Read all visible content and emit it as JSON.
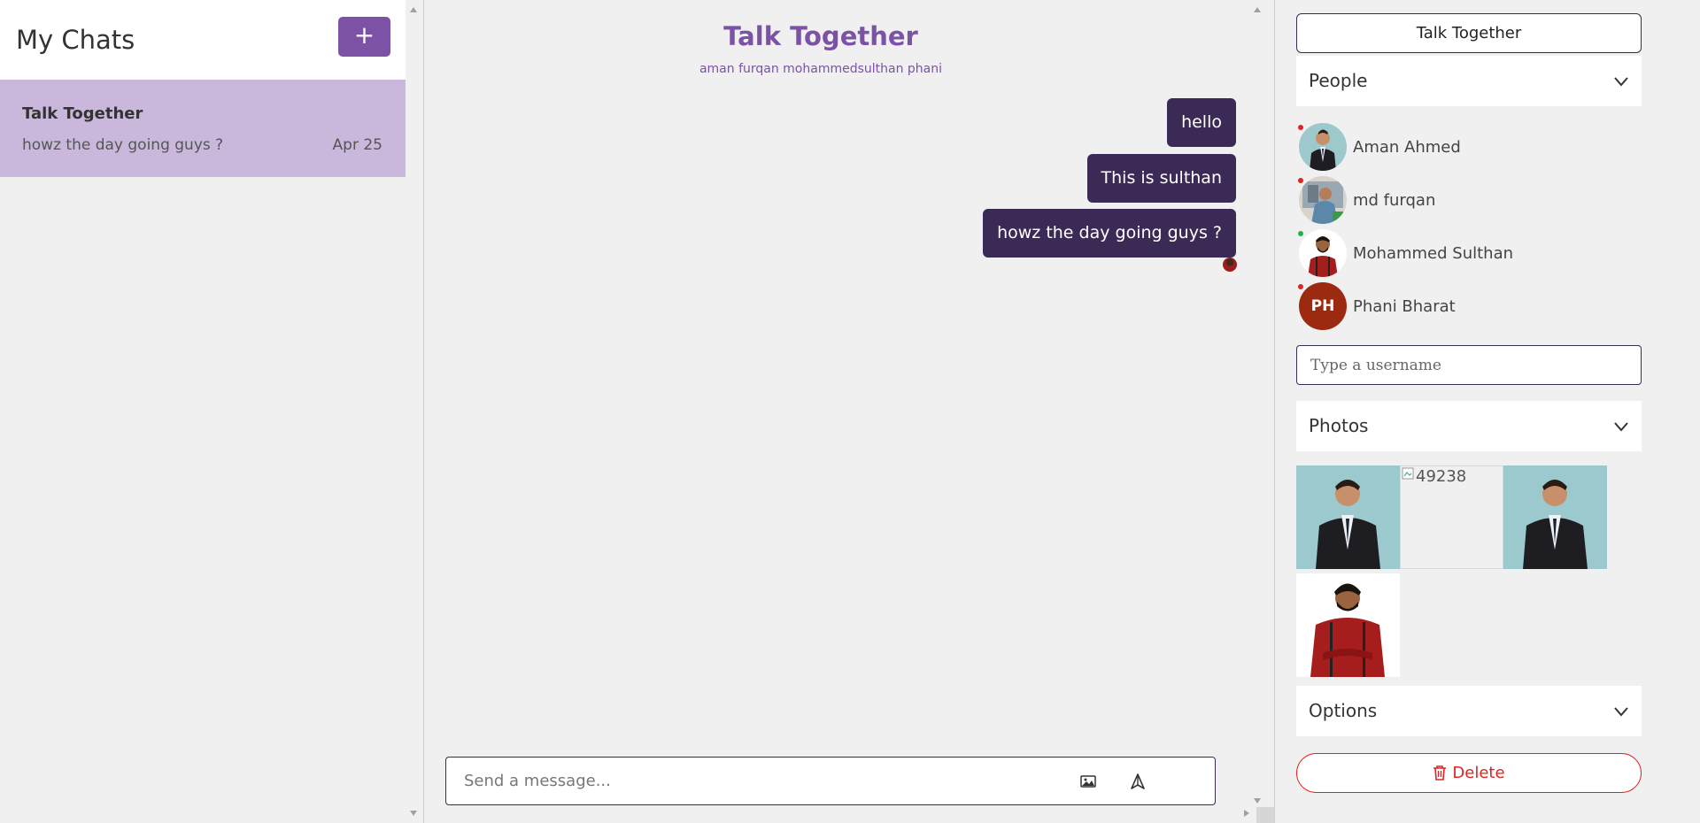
{
  "left": {
    "title": "My Chats",
    "add_label": "+",
    "chats": [
      {
        "name": "Talk Together",
        "last_message": "howz the day going guys ?",
        "date": "Apr 25"
      }
    ]
  },
  "center": {
    "room_title": "Talk Together",
    "members": "aman furqan mohammedsulthan phani",
    "messages": [
      {
        "text": "hello"
      },
      {
        "text": "This is sulthan"
      },
      {
        "text": "howz the day going guys ?"
      }
    ],
    "composer": {
      "placeholder": "Send a message..."
    }
  },
  "right": {
    "group_name": "Talk Together",
    "people_label": "People",
    "people": [
      {
        "name": "Aman Ahmed",
        "status_color": "#e02424"
      },
      {
        "name": "md furqan",
        "status_color": "#e02424"
      },
      {
        "name": "Mohammed Sulthan",
        "status_color": "#22b14c"
      },
      {
        "name": "Phani Bharat",
        "initials": "PH",
        "status_color": "#e02424"
      }
    ],
    "username_placeholder": "Type a username",
    "photos_label": "Photos",
    "broken_photo_alt": "49238",
    "options_label": "Options",
    "delete_label": "Delete"
  },
  "colors": {
    "accent": "#7b52a6",
    "bubble": "#3b2a55",
    "selected_chat": "#c9b8dc",
    "danger": "#e02424"
  }
}
